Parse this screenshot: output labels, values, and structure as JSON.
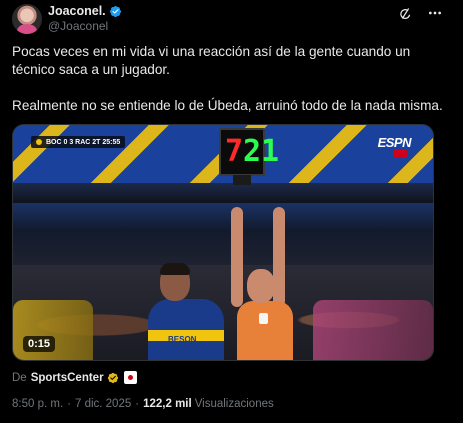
{
  "header": {
    "display_name": "Joaconel.",
    "handle": "@Joaconel",
    "verified": true,
    "icons": [
      "grok-icon",
      "more-icon"
    ]
  },
  "tweet": {
    "paragraphs": [
      "Pocas veces en mi vida vi una reacción así de la gente cuando un técnico saca a un jugador.",
      "Realmente no se entiende lo de Úbeda, arruinó todo de la nada misma."
    ]
  },
  "media": {
    "scorebug": "BOC 0  3  RAC  2T  25:55",
    "broadcaster": "ESPN",
    "board_out": "7",
    "board_in": "21",
    "sponsor": "BESON",
    "duration": "0:15"
  },
  "attribution": {
    "prefix": "De",
    "source": "SportsCenter"
  },
  "meta": {
    "time": "8:50 p. m.",
    "date": "7 dic. 2025",
    "views": "122,2 mil",
    "views_label": "Visualizaciones"
  },
  "colors": {
    "background": "#000000",
    "text": "#e7e9ea",
    "muted": "#71767b",
    "verified_blue": "#1d9bf0",
    "verified_gold": "#e2b719"
  }
}
